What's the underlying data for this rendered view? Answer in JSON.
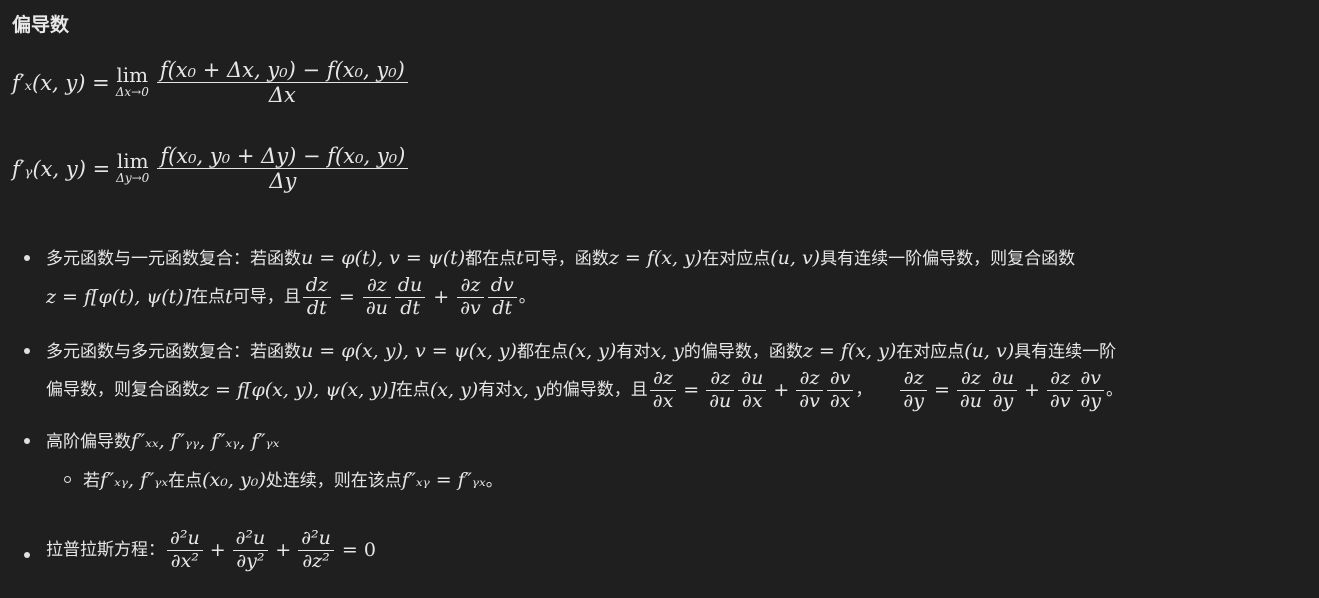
{
  "heading": "偏导数",
  "formula1": {
    "lhs": "f′ₓ(x, y) =",
    "lim_sub": "Δx→0",
    "num": "f(x₀ + Δx, y₀) − f(x₀, y₀)",
    "den": "Δx"
  },
  "formula2": {
    "lhs": "f′ᵧ(x, y) =",
    "lim_sub": "Δy→0",
    "num": "f(x₀, y₀ + Δy) − f(x₀, y₀)",
    "den": "Δy"
  },
  "lim_word": "lim",
  "bullets": {
    "b1_line1_a": "多元函数与一元函数复合：若函数",
    "b1_line1_m1": "u = φ(t), v = ψ(t)",
    "b1_line1_b": "都在点",
    "b1_line1_m2": "t",
    "b1_line1_c": "可导，函数",
    "b1_line1_m3": "z = f(x, y)",
    "b1_line1_d": "在对应点",
    "b1_line1_m4": "(u, v)",
    "b1_line1_e": "具有连续一阶偏导数，则复合函数",
    "b1_line2_m1": "z = f[φ(t), ψ(t)]",
    "b1_line2_a": "在点",
    "b1_line2_m2": "t",
    "b1_line2_b": "可导，且",
    "b1_line2_end": "。",
    "b2_line1_a": "多元函数与多元函数复合：若函数",
    "b2_line1_m1": "u = φ(x, y), v = ψ(x, y)",
    "b2_line1_b": "都在点",
    "b2_line1_m2": "(x, y)",
    "b2_line1_c": "有对",
    "b2_line1_m3": "x, y",
    "b2_line1_d": "的偏导数，函数",
    "b2_line1_m4": "z = f(x, y)",
    "b2_line1_e": "在对应点",
    "b2_line1_m5": "(u, v)",
    "b2_line1_f": "具有连续一阶",
    "b2_line2_a": "偏导数，则复合函数",
    "b2_line2_m1": "z = f[φ(x, y), ψ(x, y)]",
    "b2_line2_b": "在点",
    "b2_line2_m2": "(x, y)",
    "b2_line2_c": "有对",
    "b2_line2_m3": "x, y",
    "b2_line2_d": "的偏导数，且",
    "b2_line2_end": "。",
    "b3_a": "高阶偏导数",
    "b3_m": "f″ₓₓ, f″ᵧᵧ, f″ₓᵧ, f″ᵧₓ",
    "b3s_a": "若",
    "b3s_m1": "f″ₓᵧ, f″ᵧₓ",
    "b3s_b": "在点",
    "b3s_m2": "(x₀, y₀)",
    "b3s_c": "处连续，则在该点",
    "b3s_m3": "f″ₓᵧ = f″ᵧₓ",
    "b3s_end": "。",
    "b4_a": "拉普拉斯方程：",
    "b4_eq": "= 0"
  },
  "fracs": {
    "dz": "dz",
    "dt": "dt",
    "du": "du",
    "dv": "dv",
    "pz": "∂z",
    "pu": "∂u",
    "pv": "∂v",
    "px": "∂x",
    "py": "∂y",
    "p2u": "∂²u",
    "px2": "∂x²",
    "py2": "∂y²",
    "pz2": "∂z²"
  },
  "ops": {
    "eq": "=",
    "plus": "+",
    "comma": "，"
  }
}
